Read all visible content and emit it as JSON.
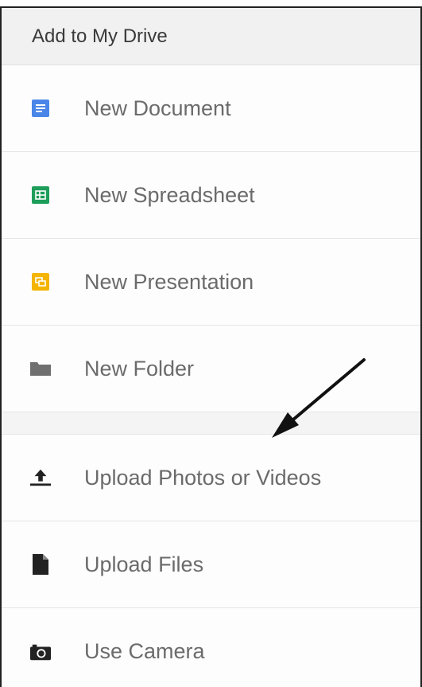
{
  "menu": {
    "title": "Add to My Drive",
    "create_items": [
      {
        "label": "New Document",
        "icon": "doc-icon",
        "color": "#4a86e8"
      },
      {
        "label": "New Spreadsheet",
        "icon": "sheet-icon",
        "color": "#1e9e5a"
      },
      {
        "label": "New Presentation",
        "icon": "slides-icon",
        "color": "#f4b400"
      },
      {
        "label": "New Folder",
        "icon": "folder-icon",
        "color": "#6f6f6f"
      }
    ],
    "upload_items": [
      {
        "label": "Upload Photos or Videos",
        "icon": "upload-icon"
      },
      {
        "label": "Upload Files",
        "icon": "file-icon"
      },
      {
        "label": "Use Camera",
        "icon": "camera-icon"
      }
    ]
  }
}
